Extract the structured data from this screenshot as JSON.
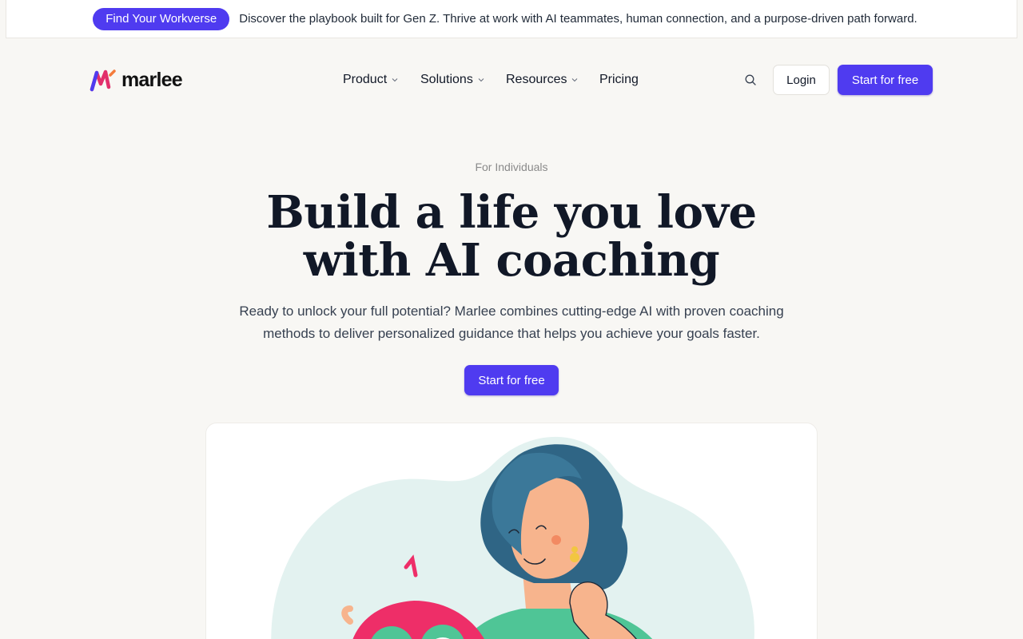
{
  "announcement": {
    "pill_label": "Find Your Workverse",
    "text": "Discover the playbook built for Gen Z. Thrive at work with AI teammates, human connection, and a purpose-driven path forward."
  },
  "header": {
    "logo_text": "marlee",
    "nav": [
      {
        "label": "Product",
        "has_dropdown": true
      },
      {
        "label": "Solutions",
        "has_dropdown": true
      },
      {
        "label": "Resources",
        "has_dropdown": true
      },
      {
        "label": "Pricing",
        "has_dropdown": false
      }
    ],
    "search_icon": "search-icon",
    "login_label": "Login",
    "cta_label": "Start for free"
  },
  "hero": {
    "eyebrow": "For Individuals",
    "title_line1": "Build a life you love",
    "title_line2": "with AI coaching",
    "subtitle": "Ready to unlock your full potential? Marlee combines cutting-edge AI with proven coaching methods to deliver personalized guidance that helps you achieve your goals faster.",
    "cta_label": "Start for free"
  },
  "colors": {
    "brand": "#4f3bf0",
    "background": "#f8f7f4",
    "illustration_blob": "#e3f2f0",
    "hair": "#2f6585",
    "skin": "#f7b48d",
    "shirt": "#4fc596",
    "mascot": "#ee2e68"
  }
}
